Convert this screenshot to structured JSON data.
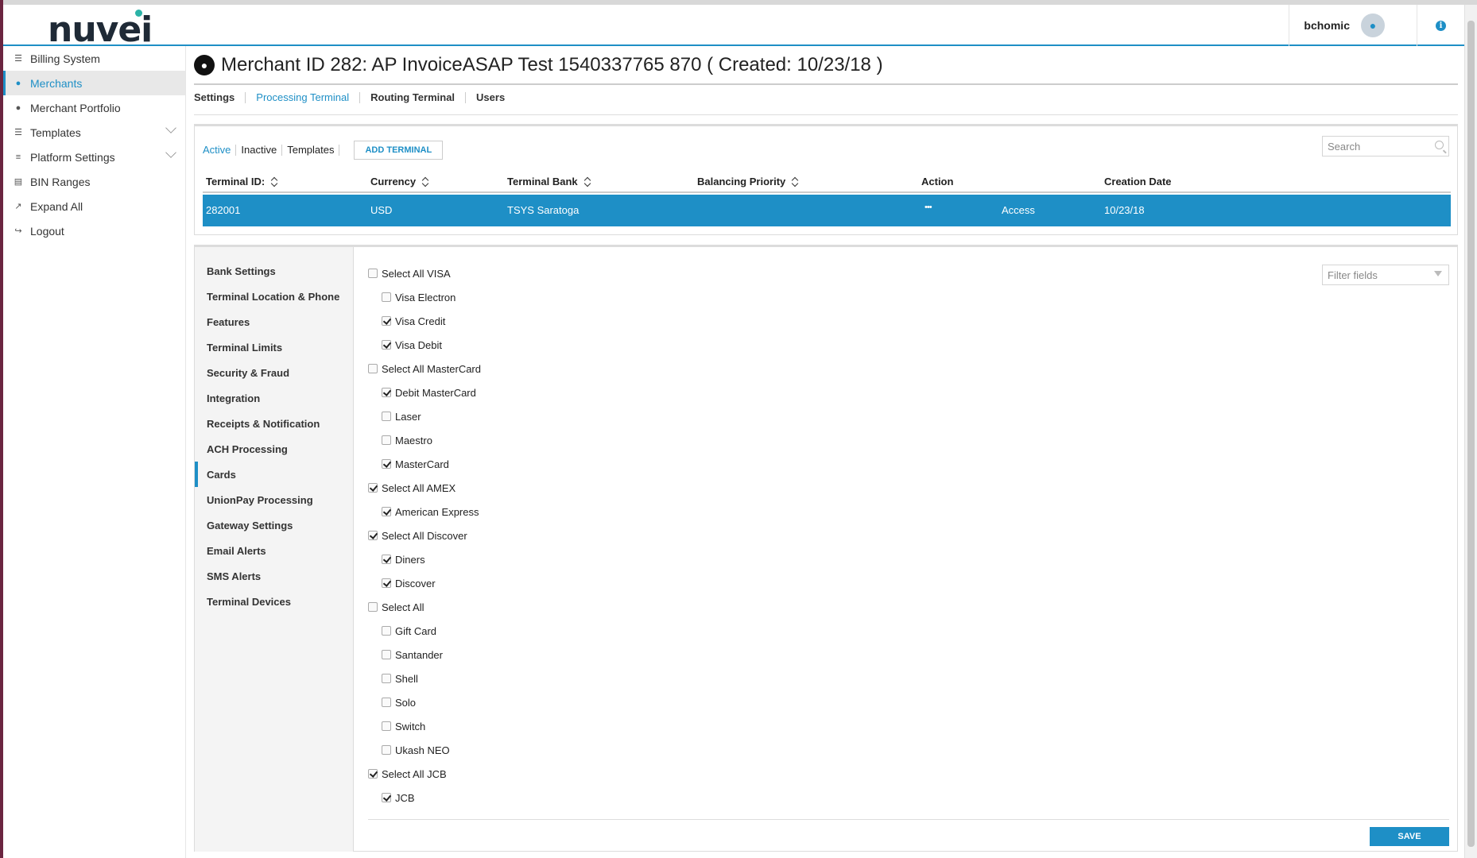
{
  "header": {
    "logo": "nuvei",
    "username": "bchomic",
    "avatar_icon": "user-icon",
    "info_icon": "info-icon",
    "accent_color": "#1e8fc6"
  },
  "sidebar": {
    "items": [
      {
        "label": "Billing System",
        "icon": "list-icon"
      },
      {
        "label": "Merchants",
        "icon": "users-icon"
      },
      {
        "label": "Merchant Portfolio",
        "icon": "user-plus-icon"
      },
      {
        "label": "Templates",
        "icon": "list-icon"
      },
      {
        "label": "Platform Settings",
        "icon": "sliders-icon"
      },
      {
        "label": "BIN Ranges",
        "icon": "card-icon"
      },
      {
        "label": "Expand All",
        "icon": "expand-icon"
      },
      {
        "label": "Logout",
        "icon": "logout-icon"
      }
    ]
  },
  "page": {
    "title": "Merchant ID 282: AP InvoiceASAP Test 1540337765 870 ( Created: 10/23/18 )"
  },
  "tabs": [
    "Settings",
    "Processing Terminal",
    "Routing Terminal",
    "Users"
  ],
  "terminals": {
    "subtabs": [
      "Active",
      "Inactive",
      "Templates"
    ],
    "add_button": "ADD TERMINAL",
    "search_placeholder": "Search",
    "columns": [
      "Terminal ID:",
      "Currency",
      "Terminal Bank",
      "Balancing Priority",
      "Action",
      "Creation Date"
    ],
    "row": {
      "terminal_id": "282001",
      "currency": "USD",
      "bank": "TSYS Saratoga",
      "priority": "",
      "action_more": "•••",
      "action_access": "Access",
      "created": "10/23/18"
    }
  },
  "details": {
    "nav": [
      "Bank Settings",
      "Terminal Location & Phone",
      "Features",
      "Terminal Limits",
      "Security & Fraud",
      "Integration",
      "Receipts & Notification",
      "ACH Processing",
      "Cards",
      "UnionPay Processing",
      "Gateway Settings",
      "Email Alerts",
      "SMS Alerts",
      "Terminal Devices"
    ],
    "filter_placeholder": "Filter fields",
    "cards": [
      {
        "label": "Select All VISA",
        "checked": false,
        "child": false
      },
      {
        "label": "Visa Electron",
        "checked": false,
        "child": true
      },
      {
        "label": "Visa Credit",
        "checked": true,
        "child": true
      },
      {
        "label": "Visa Debit",
        "checked": true,
        "child": true
      },
      {
        "label": "Select All MasterCard",
        "checked": false,
        "child": false
      },
      {
        "label": "Debit MasterCard",
        "checked": true,
        "child": true
      },
      {
        "label": "Laser",
        "checked": false,
        "child": true
      },
      {
        "label": "Maestro",
        "checked": false,
        "child": true
      },
      {
        "label": "MasterCard",
        "checked": true,
        "child": true
      },
      {
        "label": "Select All AMEX",
        "checked": true,
        "child": false
      },
      {
        "label": "American Express",
        "checked": true,
        "child": true
      },
      {
        "label": "Select All Discover",
        "checked": true,
        "child": false
      },
      {
        "label": "Diners",
        "checked": true,
        "child": true
      },
      {
        "label": "Discover",
        "checked": true,
        "child": true
      },
      {
        "label": "Select All",
        "checked": false,
        "child": false
      },
      {
        "label": "Gift Card",
        "checked": false,
        "child": true
      },
      {
        "label": "Santander",
        "checked": false,
        "child": true
      },
      {
        "label": "Shell",
        "checked": false,
        "child": true
      },
      {
        "label": "Solo",
        "checked": false,
        "child": true
      },
      {
        "label": "Switch",
        "checked": false,
        "child": true
      },
      {
        "label": "Ukash NEO",
        "checked": false,
        "child": true
      },
      {
        "label": "Select All JCB",
        "checked": true,
        "child": false
      },
      {
        "label": "JCB",
        "checked": true,
        "child": true
      }
    ],
    "save_button": "SAVE"
  }
}
